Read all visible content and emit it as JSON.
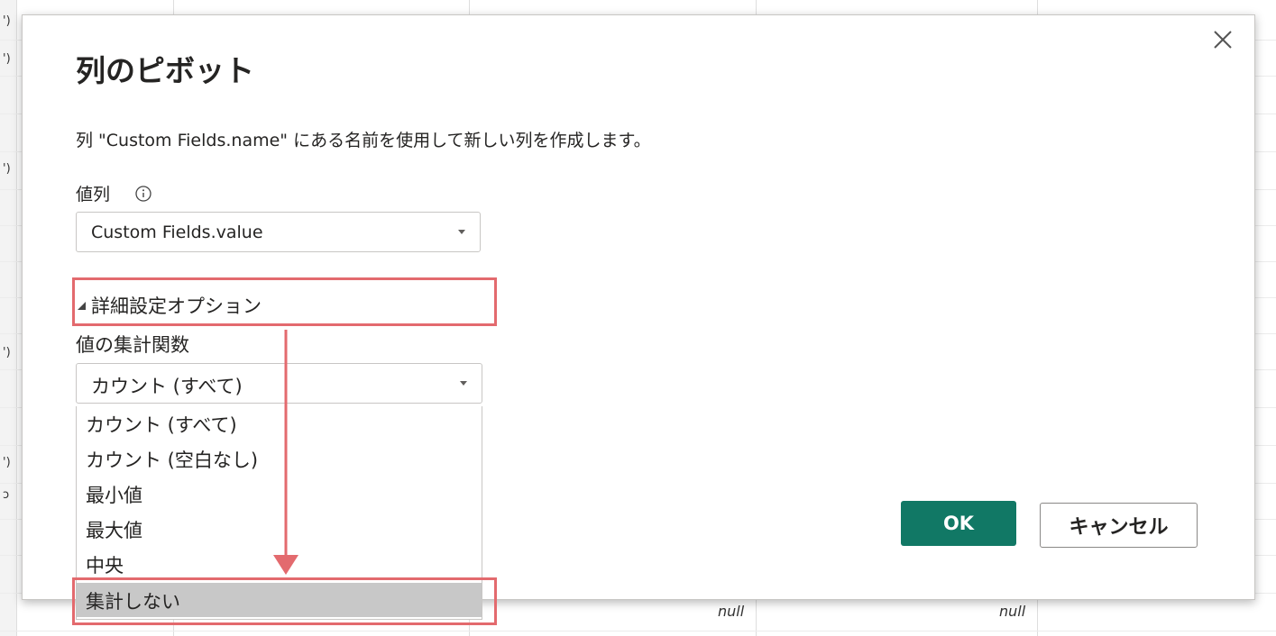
{
  "dialog": {
    "title": "列のピボット",
    "description": "列 \"Custom Fields.name\" にある名前を使用して新しい列を作成します。",
    "values_column_label": "値列",
    "values_column_value": "Custom Fields.value",
    "advanced_options_label": "詳細設定オプション",
    "aggregate_label": "値の集計関数",
    "aggregate_value": "カウント (すべて)",
    "aggregate_options": [
      "カウント (すべて)",
      "カウント (空白なし)",
      "最小値",
      "最大値",
      "中央",
      "集計しない"
    ],
    "selected_option": "集計しない",
    "ok_label": "OK",
    "cancel_label": "キャンセル"
  },
  "background": {
    "null_cells": [
      "null",
      "null"
    ],
    "row_marks": [
      "')",
      "')",
      "')",
      "')",
      "')",
      "ɔ"
    ]
  },
  "colors": {
    "ok_button": "#117865",
    "highlight_annotation": "#e36a6e",
    "selected_option_bg": "#c8c8c8"
  },
  "icons": {
    "close": "close-icon",
    "info": "info-icon",
    "dropdown": "chevron-down-icon",
    "expand": "triangle-icon"
  }
}
